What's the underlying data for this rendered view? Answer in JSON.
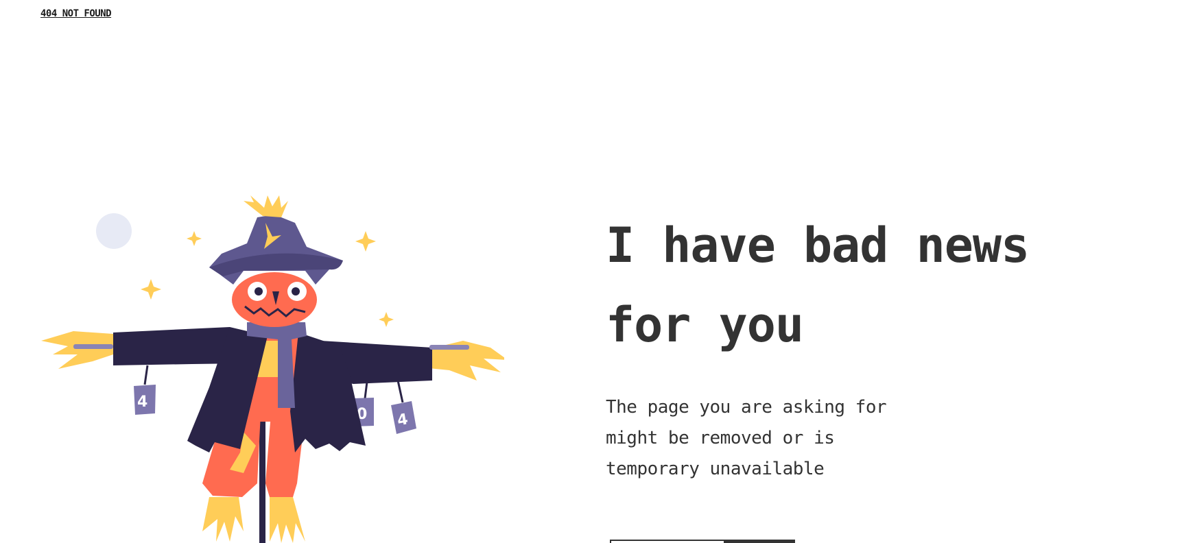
{
  "header": {
    "brand_link": "404 NOT FOUND"
  },
  "hero": {
    "headline_line1": "I have bad news",
    "headline_line2": "for you",
    "subtext": "The page you are asking for might be removed or is temporary unavailable"
  },
  "actions": {
    "primary_label": "",
    "secondary_label": ""
  },
  "illustration": {
    "icon": "scarecrow-illustration",
    "can_labels": [
      "4",
      "0",
      "4"
    ],
    "colors": {
      "hat": "#5e588f",
      "face": "#ff6b50",
      "coat": "#2a2447",
      "straw": "#ffcd58",
      "scarf": "#6a649b",
      "cans": "#7d76ad",
      "moon": "#e7eaf5",
      "text": "#333333"
    }
  }
}
